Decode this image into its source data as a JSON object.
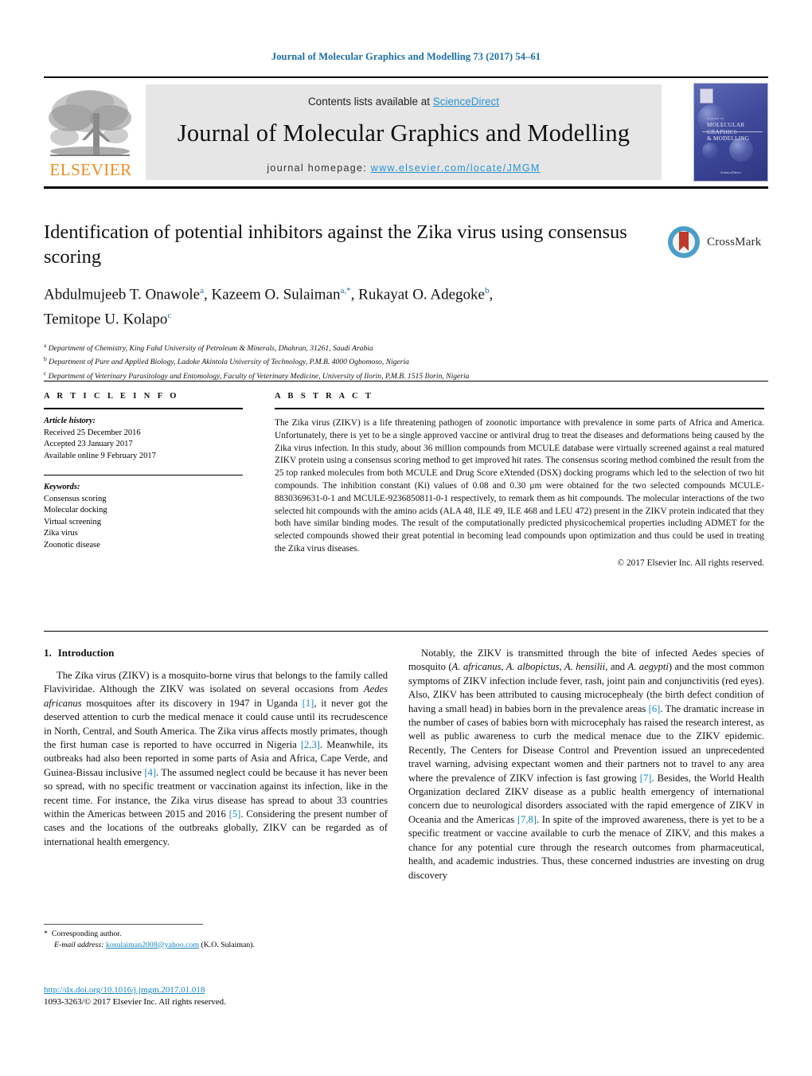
{
  "running_head": "Journal of Molecular Graphics and Modelling 73 (2017) 54–61",
  "masthead": {
    "contents_prefix": "Contents lists available at ",
    "contents_link": "ScienceDirect",
    "journal_name": "Journal of Molecular Graphics and Modelling",
    "homepage_prefix": "journal homepage: ",
    "homepage_url": "www.elsevier.com/locate/JMGM",
    "publisher_logo_text": "ELSEVIER",
    "cover": {
      "title_line1": "MOLECULAR GRAPHICS",
      "title_line2": "& MODELLING",
      "eyebrow": "Journal of",
      "footer": "ScienceDirect"
    }
  },
  "crossmark": {
    "label": "CrossMark",
    "icon": "crossmark-icon"
  },
  "article": {
    "title": "Identification of potential inhibitors against the Zika virus using consensus scoring",
    "authors": [
      {
        "name": "Abdulmujeeb T. Onawole",
        "marks": "a"
      },
      {
        "name": "Kazeem O. Sulaiman",
        "marks": "a,*"
      },
      {
        "name": "Rukayat O. Adegoke",
        "marks": "b"
      },
      {
        "name": "Temitope U. Kolapo",
        "marks": "c"
      }
    ],
    "affiliations": [
      {
        "mark": "a",
        "text": "Department of Chemistry, King Fahd University of Petroleum & Minerals, Dhahran, 31261, Saudi Arabia"
      },
      {
        "mark": "b",
        "text": "Department of Pure and Applied Biology, Ladoke Akintola University of Technology, P.M.B. 4000 Ogbomoso, Nigeria"
      },
      {
        "mark": "c",
        "text": "Department of Veterinary Parasitology and Entomology, Faculty of Veterinary Medicine, University of Ilorin, P.M.B. 1515 Ilorin, Nigeria"
      }
    ]
  },
  "article_info": {
    "heading": "A R T I C L E   I N F O",
    "history_label": "Article history:",
    "history": [
      "Received 25 December 2016",
      "Accepted 23 January 2017",
      "Available online 9 February 2017"
    ],
    "keywords_label": "Keywords:",
    "keywords": [
      "Consensus scoring",
      "Molecular docking",
      "Virtual screening",
      "Zika virus",
      "Zoonotic disease"
    ]
  },
  "abstract": {
    "heading": "A B S T R A C T",
    "text": "The Zika virus (ZIKV) is a life threatening pathogen of zoonotic importance with prevalence in some parts of Africa and America. Unfortunately, there is yet to be a single approved vaccine or antiviral drug to treat the diseases and deformations being caused by the Zika virus infection. In this study, about 36 million compounds from MCULE database were virtually screened against a real matured ZIKV protein using a consensus scoring method to get improved hit rates. The consensus scoring method combined the result from the 25 top ranked molecules from both MCULE and Drug Score eXtended (DSX) docking programs which led to the selection of two hit compounds. The inhibition constant (Ki) values of 0.08 and 0.30 μm were obtained for the two selected compounds MCULE-8830369631-0-1 and MCULE-9236850811-0-1 respectively, to remark them as hit compounds. The molecular interactions of the two selected hit compounds with the amino acids (ALA 48, ILE 49, ILE 468 and LEU 472) present in the ZIKV protein indicated that they both have similar binding modes. The result of the computationally predicted physicochemical properties including ADMET for the selected compounds showed their great potential in becoming lead compounds upon optimization and thus could be used in treating the Zika virus diseases.",
    "copyright": "© 2017 Elsevier Inc. All rights reserved."
  },
  "body": {
    "section_number": "1.",
    "section_title": "Introduction",
    "left_paragraph_html": "The Zika virus (ZIKV) is a mosquito-borne virus that belongs to the family called Flaviviridae. Although the ZIKV was isolated on several occasions from <span class=\"it\">Aedes africanus</span> mosquitoes after its discovery in 1947 in Uganda <span class=\"ref\">[1]</span>, it never got the deserved attention to curb the medical menace it could cause until its recrudescence in North, Central, and South America. The Zika virus affects mostly primates, though the first human case is reported to have occurred in Nigeria <span class=\"ref\">[2,3]</span>. Meanwhile, its outbreaks had also been reported in some parts of Asia and Africa, Cape Verde, and Guinea-Bissau inclusive <span class=\"ref\">[4]</span>. The assumed neglect could be because it has never been so spread, with no specific treatment or vaccination against its infection, like in the recent time. For instance, the Zika virus disease has spread to about 33 countries within the Americas between 2015 and 2016 <span class=\"ref\">[5]</span>. Considering the present number of cases and the locations of the outbreaks globally, ZIKV can be regarded as of international health emergency.",
    "right_paragraph_html": "Notably, the ZIKV is transmitted through the bite of infected Aedes species of mosquito (<span class=\"it\">A. africanus, A. albopictus, A. hensilii,</span> and <span class=\"it\">A. aegypti</span>) and the most common symptoms of ZIKV infection include fever, rash, joint pain and conjunctivitis (red eyes). Also, ZIKV has been attributed to causing microcephealy (the birth defect condition of having a small head) in babies born in the prevalence areas <span class=\"ref\">[6]</span>. The dramatic increase in the number of cases of babies born with microcephaly has raised the research interest, as well as public awareness to curb the medical menace due to the ZIKV epidemic. Recently, The Centers for Disease Control and Prevention issued an unprecedented travel warning, advising expectant women and their partners not to travel to any area where the prevalence of ZIKV infection is fast growing <span class=\"ref\">[7]</span>. Besides, the World Health Organization declared ZIKV disease as a public health emergency of international concern due to neurological disorders associated with the rapid emergence of ZIKV in Oceania and the Americas <span class=\"ref\">[7,8]</span>. In spite of the improved awareness, there is yet to be a specific treatment or vaccine available to curb the menace of ZIKV, and this makes a chance for any potential cure through the research outcomes from pharmaceutical, health, and academic industries. Thus, these concerned industries are investing on drug discovery"
  },
  "footer": {
    "corresponding_star": "*",
    "corresponding_label": "Corresponding author.",
    "email_label": "E-mail address:",
    "email": "kosulaiman2008@yahoo.com",
    "email_owner": "(K.O. Sulaiman).",
    "doi": "http://dx.doi.org/10.1016/j.jmgm.2017.01.018",
    "issn_line": "1093-3263/© 2017 Elsevier Inc. All rights reserved."
  },
  "colors": {
    "link": "#1a85c4",
    "running_head": "#1a6ca8",
    "sciencedirect": "#2a93d4",
    "elsevier_orange": "#f08a24",
    "crossmark_blue": "#4a9ec9",
    "crossmark_red": "#c0392b"
  }
}
